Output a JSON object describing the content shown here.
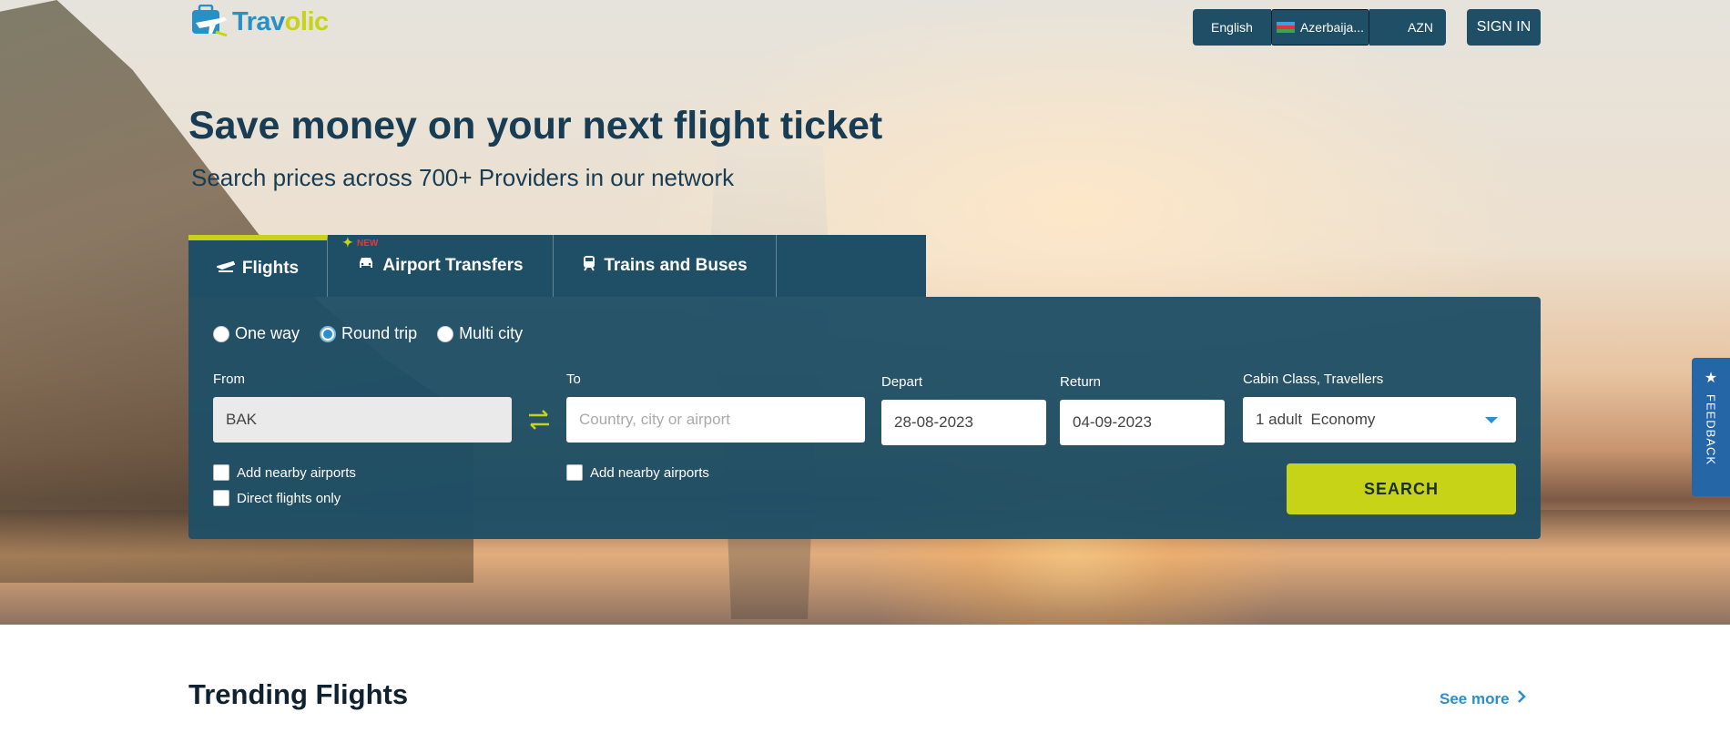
{
  "brand": {
    "name_part1": "Trav",
    "name_part2": "olic"
  },
  "topbar": {
    "language": "English",
    "country": "Azerbaija...",
    "currency": "AZN",
    "sign_in": "SIGN IN"
  },
  "hero": {
    "headline": "Save money on your next flight ticket",
    "subhead": "Search prices across 700+ Providers in our network"
  },
  "tabs": [
    {
      "label": "Flights",
      "icon": "plane-icon",
      "active": true
    },
    {
      "label": "Airport Transfers",
      "icon": "car-icon",
      "badge": "NEW"
    },
    {
      "label": "Trains and Buses",
      "icon": "train-icon"
    }
  ],
  "trip_types": [
    {
      "label": "One way",
      "selected": false
    },
    {
      "label": "Round trip",
      "selected": true
    },
    {
      "label": "Multi city",
      "selected": false
    }
  ],
  "search": {
    "from_label": "From",
    "from_value": "BAK",
    "to_label": "To",
    "to_placeholder": "Country, city or airport",
    "depart_label": "Depart",
    "depart_value": "28-08-2023",
    "return_label": "Return",
    "return_value": "04-09-2023",
    "cabin_label": "Cabin Class, Travellers",
    "cabin_value": "1 adult  Economy",
    "from_nearby": "Add nearby airports",
    "direct_only": "Direct flights only",
    "to_nearby": "Add nearby airports",
    "search_button": "SEARCH"
  },
  "feedback": {
    "label": "FEEDBACK"
  },
  "trending": {
    "title": "Trending Flights",
    "see_more": "See more"
  },
  "colors": {
    "panel": "#1f4f66",
    "accent": "#c6d317",
    "link": "#2a8fcc",
    "feedback": "#2566a6"
  }
}
